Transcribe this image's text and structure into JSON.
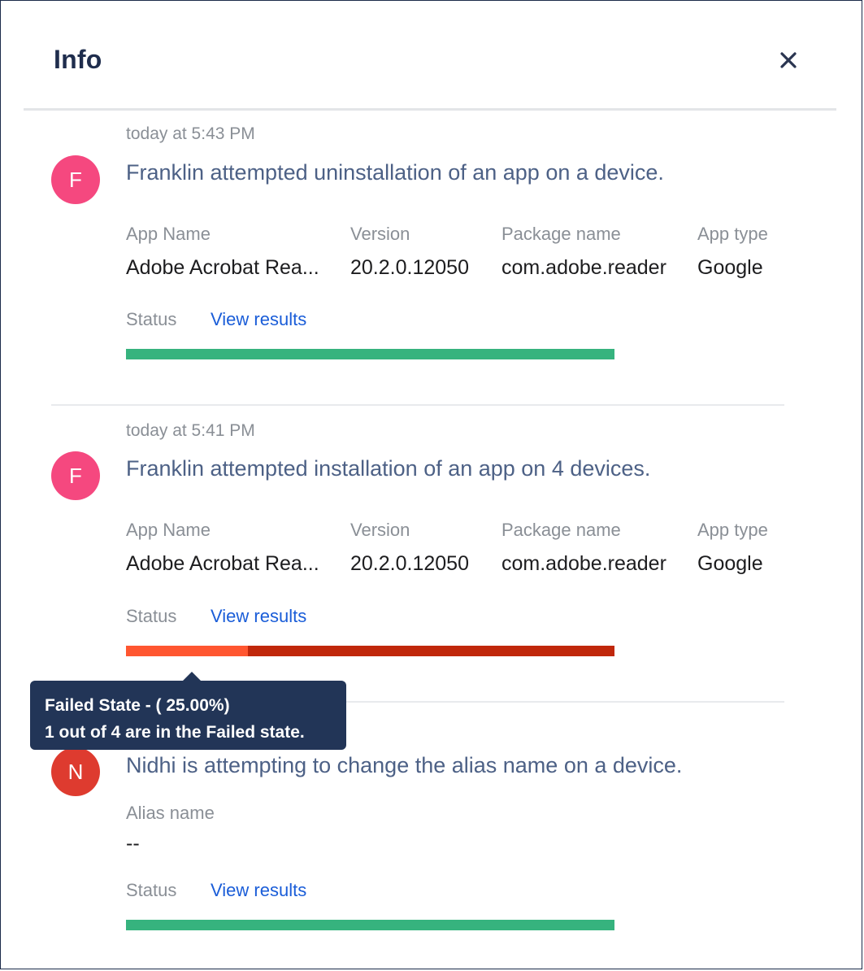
{
  "panel": {
    "title": "Info",
    "close_icon": "close-icon"
  },
  "entries": [
    {
      "time": "today at 5:43 PM",
      "avatar": {
        "initial": "F",
        "color": "#f5487f"
      },
      "message": "Franklin attempted uninstallation of an app on a device.",
      "columns": [
        {
          "label": "App Name",
          "value": "Adobe Acrobat Rea..."
        },
        {
          "label": "Version",
          "value": "20.2.0.12050"
        },
        {
          "label": "Package name",
          "value": "com.adobe.reader"
        },
        {
          "label": "App type",
          "value": "Google"
        }
      ],
      "status_label": "Status",
      "link": "View results",
      "progress": [
        {
          "fraction": 1.0,
          "color": "#36b37e"
        }
      ]
    },
    {
      "time": "today at 5:41 PM",
      "avatar": {
        "initial": "F",
        "color": "#f5487f"
      },
      "message": "Franklin attempted installation of an app on 4 devices.",
      "columns": [
        {
          "label": "App Name",
          "value": "Adobe Acrobat Rea..."
        },
        {
          "label": "Version",
          "value": "20.2.0.12050"
        },
        {
          "label": "Package name",
          "value": "com.adobe.reader"
        },
        {
          "label": "App type",
          "value": "Google"
        }
      ],
      "status_label": "Status",
      "link": "View results",
      "progress": [
        {
          "fraction": 0.25,
          "color": "#ff5630"
        },
        {
          "fraction": 0.75,
          "color": "#c0270b"
        }
      ]
    },
    {
      "avatar": {
        "initial": "N",
        "color": "#de3b2f"
      },
      "message": "Nidhi is attempting to change the alias name on a device.",
      "alias_label": "Alias name",
      "alias_value": "--",
      "status_label": "Status",
      "link": "View results",
      "progress": [
        {
          "fraction": 1.0,
          "color": "#36b37e"
        }
      ]
    }
  ],
  "tooltip": {
    "line1": "Failed State - ( 25.00%)",
    "line2": "1 out of 4 are in the Failed state."
  }
}
